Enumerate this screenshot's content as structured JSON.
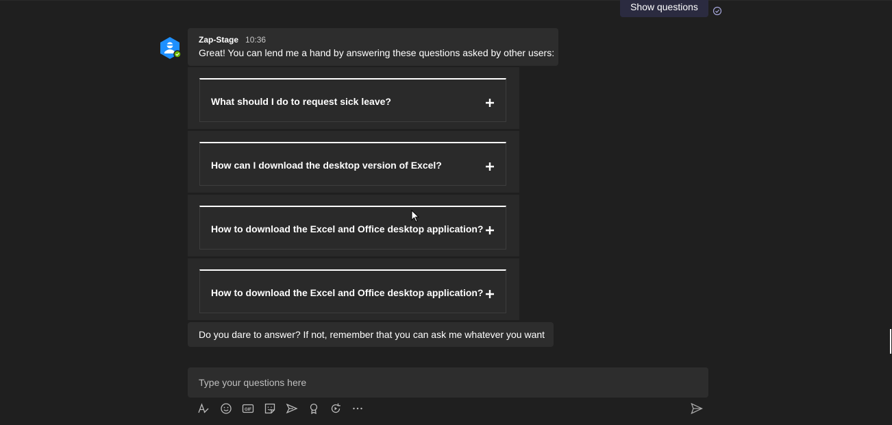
{
  "top_button": {
    "label": "Show questions"
  },
  "message": {
    "sender": "Zap-Stage",
    "time": "10:36",
    "text": "Great! You can lend me a hand by answering these questions asked by other users:"
  },
  "question_cards": [
    {
      "question": "What should I do to request sick leave?"
    },
    {
      "question": "How can I download the desktop version of Excel?"
    },
    {
      "question": "How to download the Excel and Office desktop application?"
    },
    {
      "question": "How to download the Excel and Office desktop application?"
    }
  ],
  "follow_up": {
    "text": "Do you dare to answer? If not, remember that you can ask me whatever you want"
  },
  "compose": {
    "placeholder": "Type your questions here"
  },
  "toolbar_icons": [
    "format-icon",
    "emoji-icon",
    "gif-icon",
    "sticker-icon",
    "schedule-meeting-icon",
    "praise-icon",
    "loop-icon",
    "more-options-icon"
  ],
  "colors": {
    "background": "#1f1f1f",
    "bubble": "#2d2d2d",
    "card_accent": "#ffffff",
    "avatar_blue": "#1e90ff",
    "presence_green": "#6bb700"
  }
}
